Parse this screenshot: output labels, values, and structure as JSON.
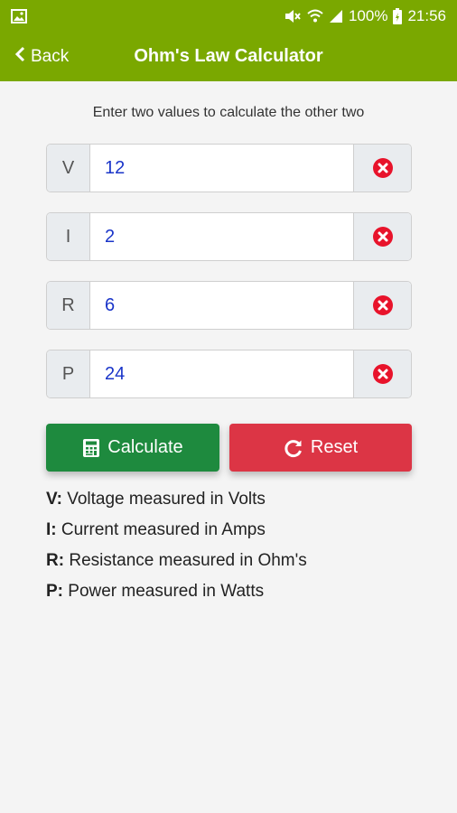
{
  "status_bar": {
    "battery": "100%",
    "time": "21:56"
  },
  "app_bar": {
    "back_label": "Back",
    "title": "Ohm's Law Calculator"
  },
  "instructions": "Enter two values to calculate the other two",
  "inputs": [
    {
      "label": "V",
      "value": "12"
    },
    {
      "label": "I",
      "value": "2"
    },
    {
      "label": "R",
      "value": "6"
    },
    {
      "label": "P",
      "value": "24"
    }
  ],
  "buttons": {
    "calculate": "Calculate",
    "reset": "Reset"
  },
  "legend": [
    {
      "key": "V:",
      "text": "Voltage measured in Volts"
    },
    {
      "key": "I:",
      "text": "Current measured in Amps"
    },
    {
      "key": "R:",
      "text": "Resistance measured in Ohm's"
    },
    {
      "key": "P:",
      "text": "Power measured in Watts"
    }
  ],
  "colors": {
    "header": "#7aa800",
    "calculate": "#1e8a3e",
    "reset": "#dc3545",
    "clear_icon": "#e8132b",
    "input_text": "#1a35c9"
  }
}
